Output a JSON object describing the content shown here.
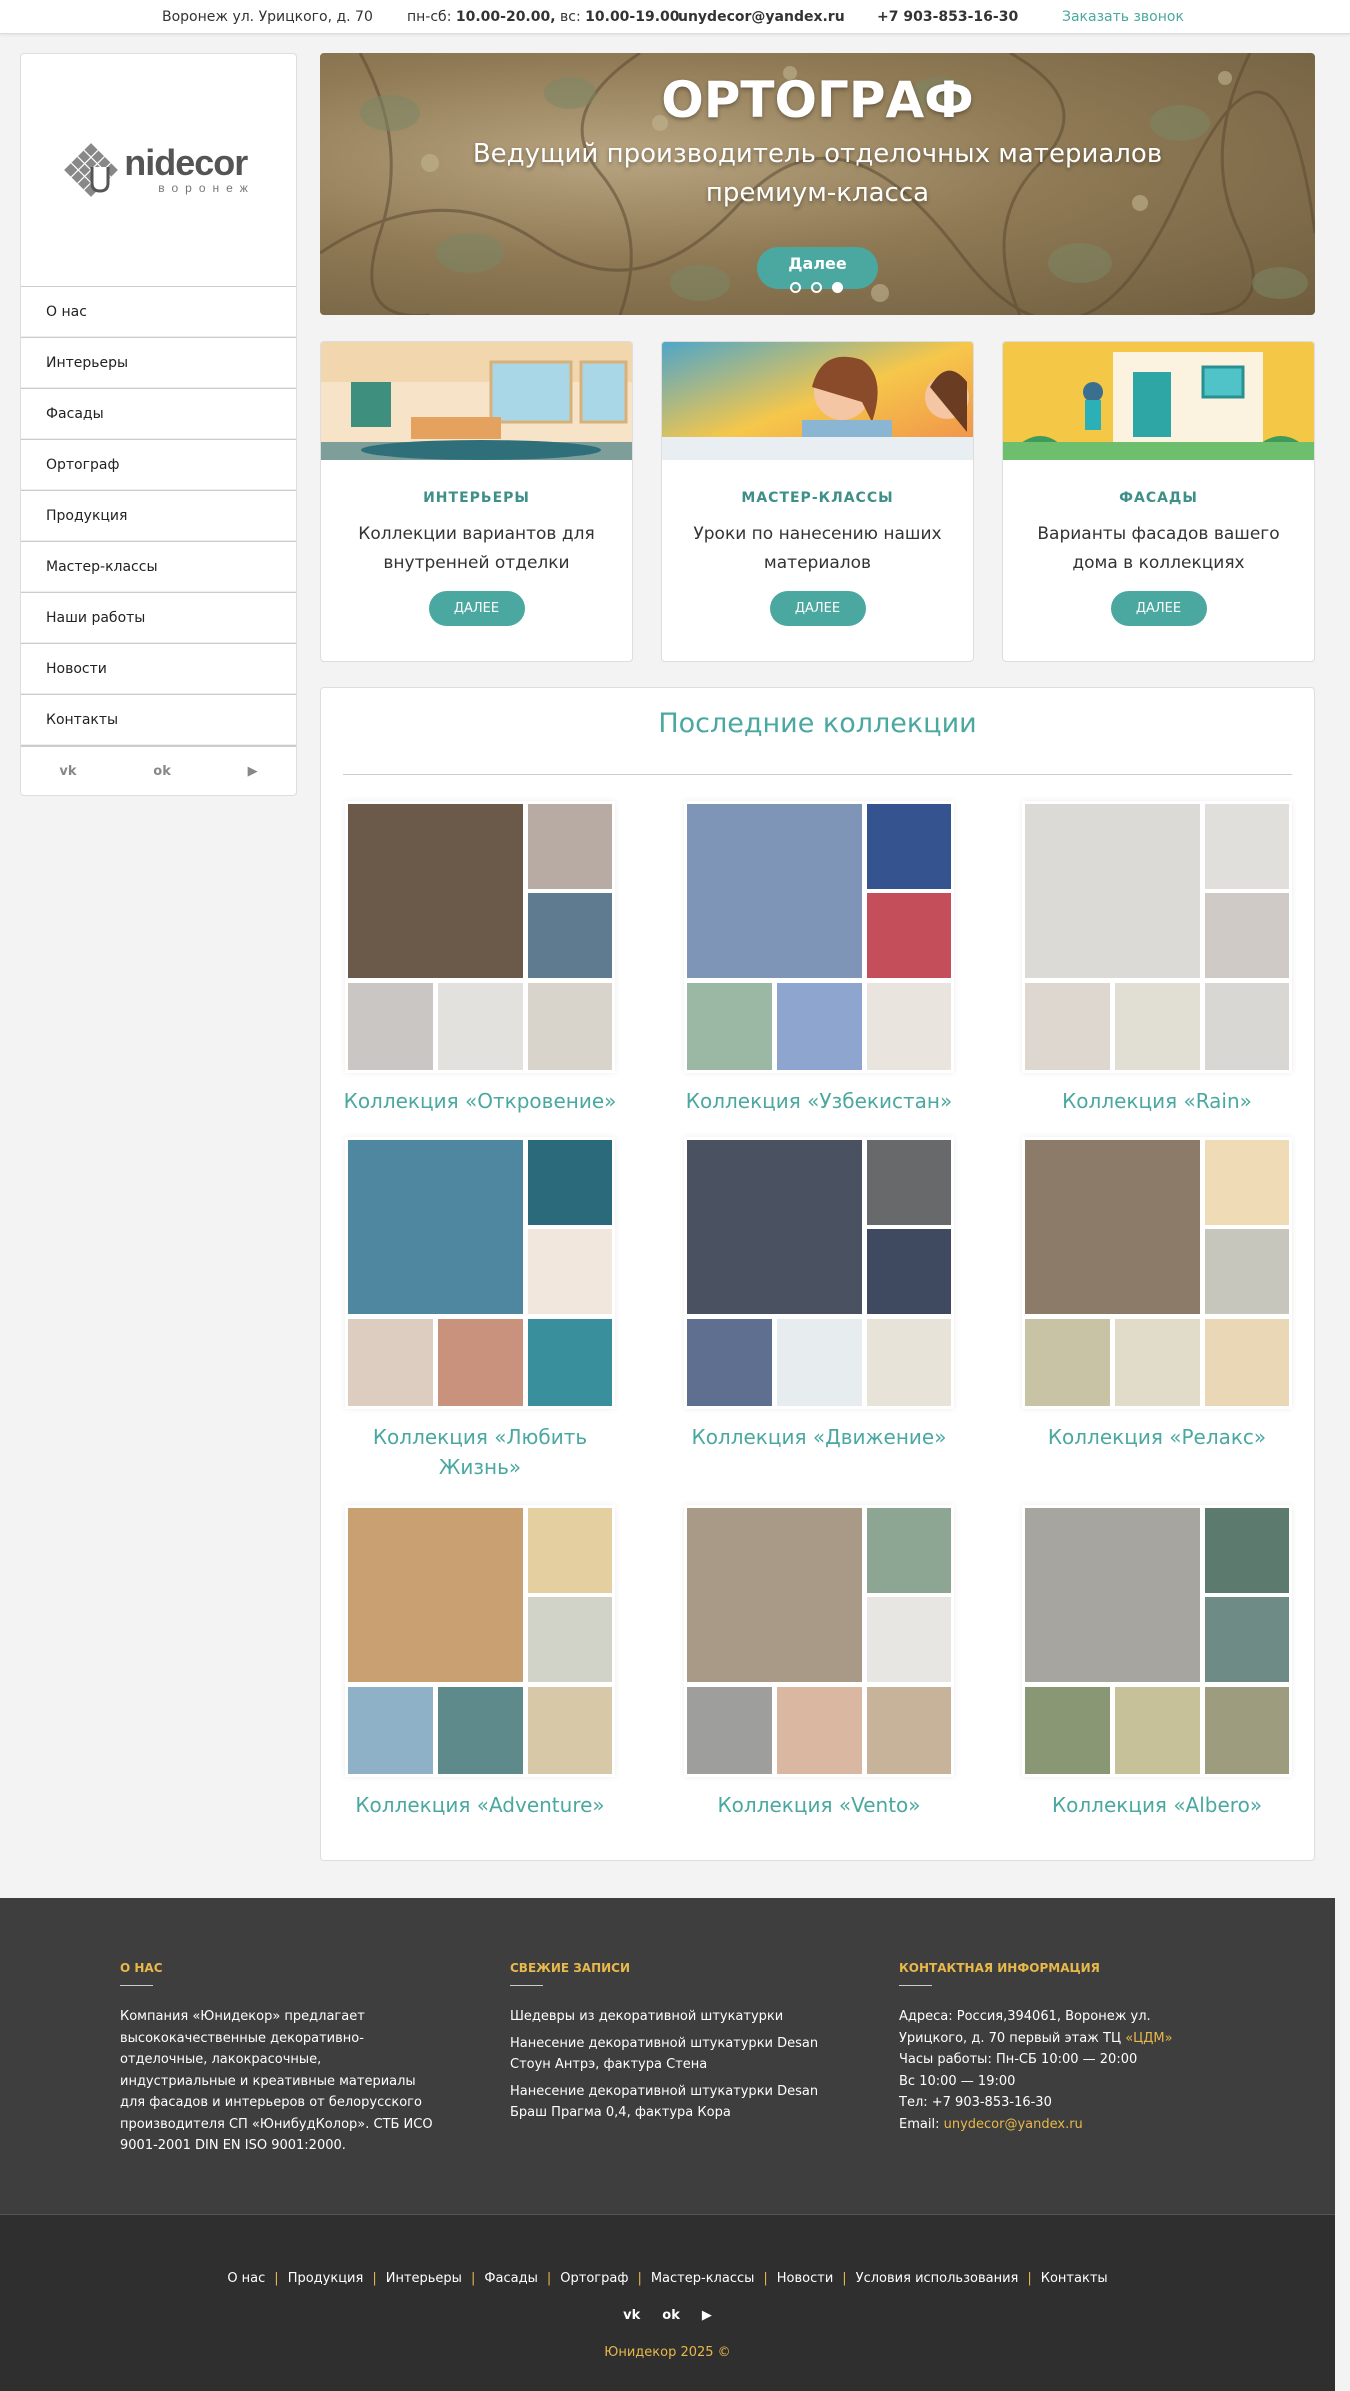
{
  "topbar": {
    "address": "Воронеж ул. Урицкого, д. 70",
    "hours_weekday_label": "пн-сб:",
    "hours_weekday": "10.00-20.00,",
    "hours_sunday_label": "вс:",
    "hours_sunday": "10.00-19.00",
    "email": "unydecor@yandex.ru",
    "phone": "+7 903-853-16-30",
    "callback": "Заказать звонок"
  },
  "logo": {
    "brand": "nidecor",
    "brand_initial": "U",
    "city": "воронеж"
  },
  "sidebar": {
    "items": [
      {
        "label": "О нас"
      },
      {
        "label": "Интерьеры"
      },
      {
        "label": "Фасады"
      },
      {
        "label": "Ортограф"
      },
      {
        "label": "Продукция"
      },
      {
        "label": "Мастер-классы"
      },
      {
        "label": "Наши работы"
      },
      {
        "label": "Новости"
      },
      {
        "label": "Контакты"
      }
    ],
    "social": {
      "vk": "vk-icon",
      "ok": "odnoklassniki-icon",
      "yt": "youtube-icon"
    }
  },
  "hero": {
    "title": "ОРТОГРАФ",
    "subtitle": "Ведущий производитель отделочных материалов премиум-класса",
    "button": "Далее",
    "slides_total": 3,
    "active_slide": 3
  },
  "cards": [
    {
      "title": "ИНТЕРЬЕРЫ",
      "text": "Коллекции вариантов для внутренней отделки",
      "button": "ДАЛЕЕ"
    },
    {
      "title": "МАСТЕР-КЛАССЫ",
      "text": "Уроки по нанесению наших материалов",
      "button": "ДАЛЕЕ"
    },
    {
      "title": "ФАСАДЫ",
      "text": "Варианты фасадов вашего дома в коллекциях",
      "button": "ДАЛЕЕ"
    }
  ],
  "collections": {
    "heading": "Последние коллекции",
    "items": [
      {
        "label": "Коллекция «Откровение»",
        "colors": [
          "#6b5a4a",
          "#b8aba3",
          "#5e7b8f",
          "#c9c6c4",
          "#e2e1de",
          "#d8d3cb"
        ]
      },
      {
        "label": "Коллекция «Узбекистан»",
        "colors": [
          "#7f95b8",
          "#34538f",
          "#c44e59",
          "#9bb8a5",
          "#8ea6cf",
          "#e9e4de"
        ]
      },
      {
        "label": "Коллекция «Rain»",
        "colors": [
          "#dcdad7",
          "#e1dfdb",
          "#cfcac6",
          "#ddd7cf",
          "#e1dfd3",
          "#d9d7d3"
        ]
      },
      {
        "label": "Коллекция «Любить Жизнь»",
        "colors": [
          "#4f87a0",
          "#2b6a7a",
          "#f1e7dc",
          "#ddcdc0",
          "#c9927d",
          "#3a8f9c"
        ]
      },
      {
        "label": "Коллекция «Движение»",
        "colors": [
          "#4a5160",
          "#68696b",
          "#3f4a61",
          "#5f6f8f",
          "#e7ecee",
          "#e8e3d8"
        ]
      },
      {
        "label": "Коллекция «Релакс»",
        "colors": [
          "#8b7b68",
          "#efdcb7",
          "#c7c6bc",
          "#c8c3a5",
          "#e1dcc9",
          "#ead7b6"
        ]
      },
      {
        "label": "Коллекция «Adventure»",
        "colors": [
          "#c9a071",
          "#e4cfa1",
          "#d2d3c8",
          "#8fb1c7",
          "#5f8a8c",
          "#d7c9a8"
        ]
      },
      {
        "label": "Коллекция «Vento»",
        "colors": [
          "#a89a86",
          "#8da593",
          "#e7e6e3",
          "#9e9e9c",
          "#d9b7a0",
          "#c6b39a"
        ]
      },
      {
        "label": "Коллекция «Albero»",
        "colors": [
          "#a7a5a0",
          "#5d7a6f",
          "#6e8b86",
          "#8a9774",
          "#c7c199",
          "#9e9c7f"
        ]
      }
    ]
  },
  "footer": {
    "about_head": "О нас",
    "about_text": "Компания «Юнидекор» предлагает высококачественные декоративно-отделочные, лакокрасочные, индустриальные и креативные материалы для фасадов и интерьеров от белорусского производителя СП «ЮнибудКолор». СТБ ИСО 9001-2001 DIN EN ISO 9001:2000.",
    "posts_head": "Свежие записи",
    "posts": [
      "Шедевры из декоративной штукатурки",
      "Нанесение декоративной штукатурки Desan Стоун Антрэ, фактура Стена",
      "Нанесение декоративной штукатурки Desan Браш Прагма 0,4, фактура Кора"
    ],
    "contact_head": "Контактная информация",
    "contact_address": "Адреса: Россия,394061, Воронеж ул. Урицкого, д. 70 первый этаж ТЦ ",
    "contact_tc": "«ЦДМ»",
    "contact_hours": "Часы работы: Пн-СБ 10:00 — 20:00",
    "contact_sunday": "Вс 10:00 — 19:00",
    "contact_phone": "Тел: +7 903-853-16-30",
    "contact_email_label": "Email: ",
    "contact_email": "unydecor@yandex.ru",
    "nav": [
      "О нас",
      "Продукция",
      "Интерьеры",
      "Фасады",
      "Ортограф",
      "Мастер-классы",
      "Новости",
      "Условия использования",
      "Контакты"
    ],
    "copyright": "Юнидекор 2025 ©"
  },
  "colors": {
    "accent": "#4aa8a0",
    "footer_accent": "#e8b84a",
    "footer_bg": "#3e3e3e"
  }
}
